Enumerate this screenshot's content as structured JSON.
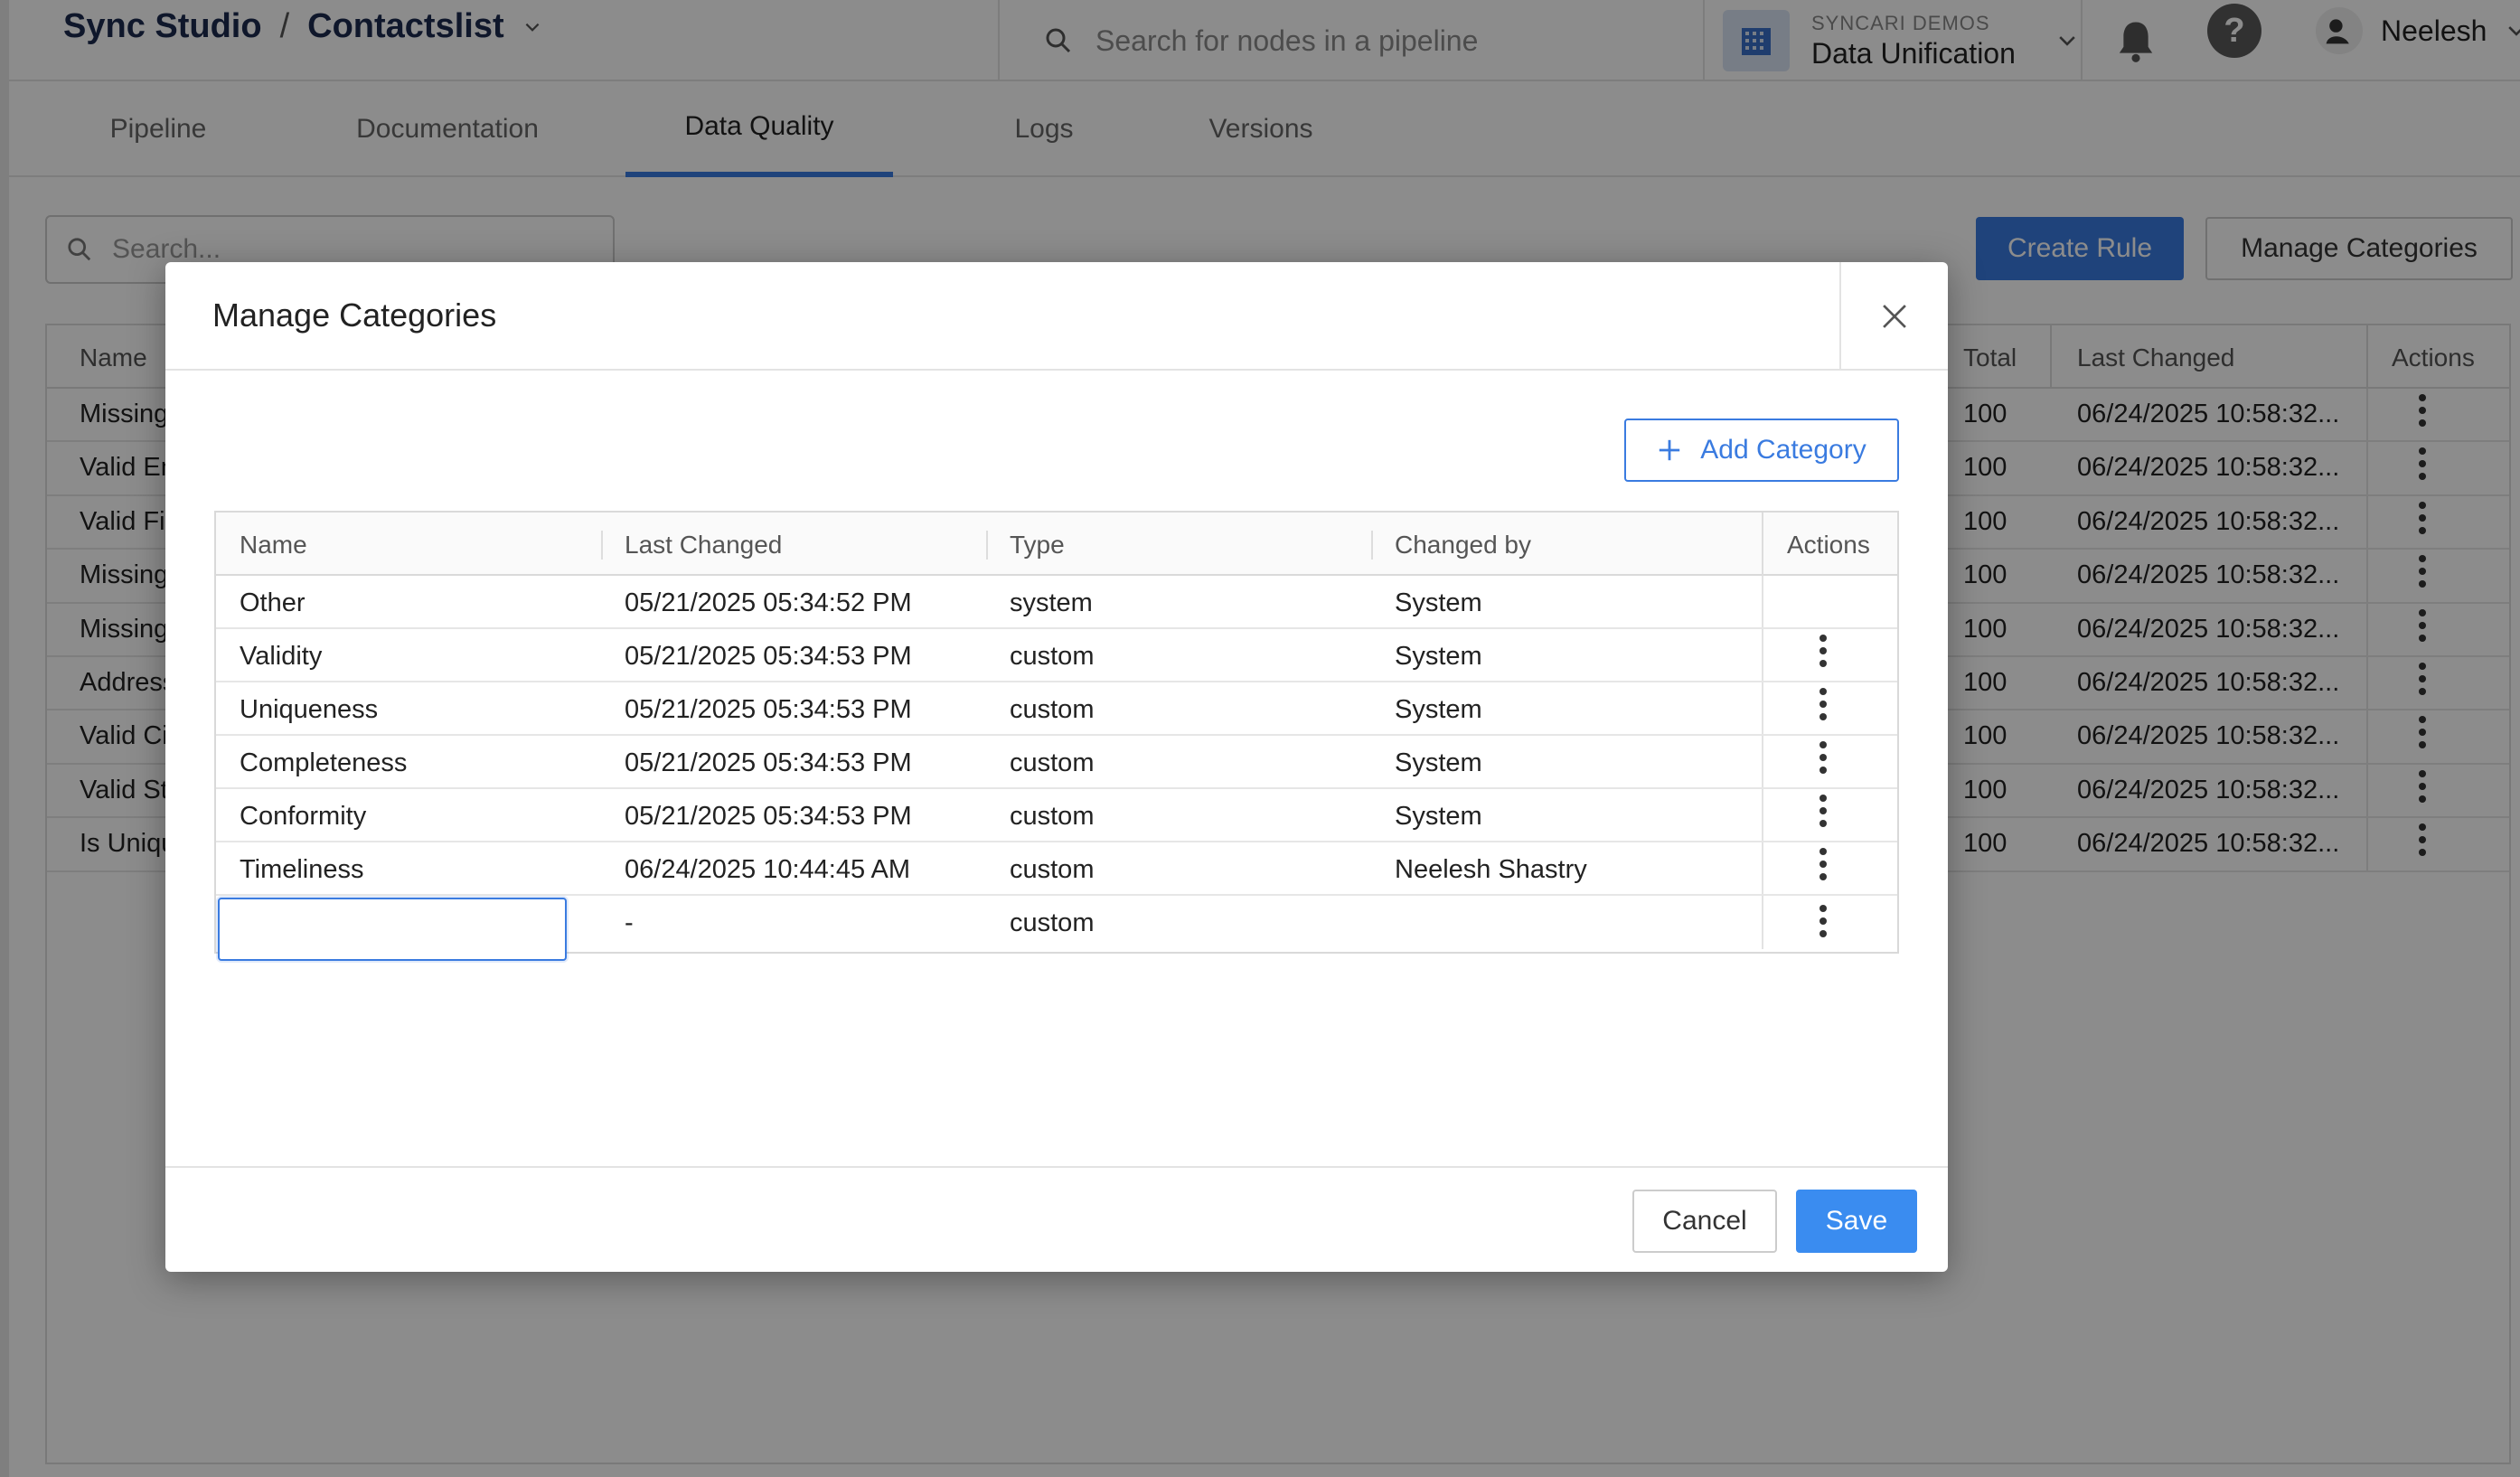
{
  "header": {
    "breadcrumb_root": "Sync Studio",
    "breadcrumb_sep": "/",
    "breadcrumb_current": "Contactslist",
    "search_placeholder": "Search for nodes in a pipeline",
    "org_label": "SYNCARI DEMOS",
    "org_name": "Data Unification",
    "help_glyph": "?",
    "user_name": "Neelesh"
  },
  "tabs": [
    {
      "label": "Pipeline"
    },
    {
      "label": "Documentation"
    },
    {
      "label": "Data Quality"
    },
    {
      "label": "Logs"
    },
    {
      "label": "Versions"
    }
  ],
  "toolbar": {
    "search_placeholder": "Search...",
    "create_rule": "Create Rule",
    "manage_categories": "Manage Categories"
  },
  "rules_table": {
    "columns": {
      "name": "Name",
      "total": "Total",
      "last_changed": "Last Changed",
      "actions": "Actions"
    },
    "rows": [
      {
        "name": "Missing I",
        "total": "100",
        "last_changed": "06/24/2025 10:58:32..."
      },
      {
        "name": "Valid Em",
        "total": "100",
        "last_changed": "06/24/2025 10:58:32..."
      },
      {
        "name": "Valid Fir",
        "total": "100",
        "last_changed": "06/24/2025 10:58:32..."
      },
      {
        "name": "Missing I",
        "total": "100",
        "last_changed": "06/24/2025 10:58:32..."
      },
      {
        "name": "Missing I",
        "total": "100",
        "last_changed": "06/24/2025 10:58:32..."
      },
      {
        "name": "Address",
        "total": "100",
        "last_changed": "06/24/2025 10:58:32..."
      },
      {
        "name": "Valid Cit",
        "total": "100",
        "last_changed": "06/24/2025 10:58:32..."
      },
      {
        "name": "Valid Sta",
        "total": "100",
        "last_changed": "06/24/2025 10:58:32..."
      },
      {
        "name": "Is Uniqu",
        "total": "100",
        "last_changed": "06/24/2025 10:58:32..."
      }
    ]
  },
  "modal": {
    "title": "Manage Categories",
    "add_category": "Add Category",
    "columns": {
      "name": "Name",
      "last_changed": "Last Changed",
      "type": "Type",
      "changed_by": "Changed by",
      "actions": "Actions"
    },
    "rows": [
      {
        "name": "Other",
        "last_changed": "05/21/2025 05:34:52 PM",
        "type": "system",
        "changed_by": "System",
        "has_actions": false
      },
      {
        "name": "Validity",
        "last_changed": "05/21/2025 05:34:53 PM",
        "type": "custom",
        "changed_by": "System",
        "has_actions": true
      },
      {
        "name": "Uniqueness",
        "last_changed": "05/21/2025 05:34:53 PM",
        "type": "custom",
        "changed_by": "System",
        "has_actions": true
      },
      {
        "name": "Completeness",
        "last_changed": "05/21/2025 05:34:53 PM",
        "type": "custom",
        "changed_by": "System",
        "has_actions": true
      },
      {
        "name": "Conformity",
        "last_changed": "05/21/2025 05:34:53 PM",
        "type": "custom",
        "changed_by": "System",
        "has_actions": true
      },
      {
        "name": "Timeliness",
        "last_changed": "06/24/2025 10:44:45 AM",
        "type": "custom",
        "changed_by": "Neelesh Shastry",
        "has_actions": true
      }
    ],
    "new_row": {
      "name_value": "",
      "last_changed": "-",
      "type": "custom",
      "changed_by": ""
    },
    "cancel": "Cancel",
    "save": "Save"
  },
  "colors": {
    "accent": "#3a7be0",
    "save": "#3a8cf0",
    "overlay": "rgba(0,0,0,0.45)"
  }
}
